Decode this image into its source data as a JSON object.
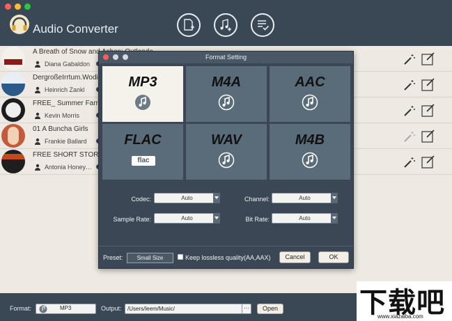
{
  "window": {
    "title": "Audio Converter"
  },
  "toolbar": {
    "icons": [
      "add-file-icon",
      "add-music-icon",
      "checklist-icon"
    ]
  },
  "books": [
    {
      "title": "A Breath of Snow and Ashes: Outlande",
      "author": "Diana Gabaldon",
      "cover_color": "#8b1c1c"
    },
    {
      "title": "DergroßeIrrtum.Wodie",
      "author": "Heinrich Zankl",
      "cover_color": "#2b5a8a"
    },
    {
      "title": "FREE_ Summer Farmer",
      "author": "Kevin Morris",
      "cover_color": "#1d1d1d"
    },
    {
      "title": "01 A Buncha Girls",
      "author": "Frankie Ballard",
      "cover_color": "#c35a3a"
    },
    {
      "title": "FREE SHORT STORY_",
      "author": "Antonia Honey…",
      "cover_color": "#c24a1e"
    }
  ],
  "dialog": {
    "title": "Format Setting",
    "formats": [
      {
        "name": "MP3",
        "selected": true
      },
      {
        "name": "M4A",
        "selected": false
      },
      {
        "name": "AAC",
        "selected": false
      },
      {
        "name": "FLAC",
        "selected": false,
        "badge": "flac"
      },
      {
        "name": "WAV",
        "selected": false
      },
      {
        "name": "M4B",
        "selected": false
      }
    ],
    "codec_label": "Codec:",
    "codec_value": "Auto",
    "channel_label": "Channel:",
    "channel_value": "Auto",
    "sample_rate_label": "Sample Rate:",
    "sample_rate_value": "Auto",
    "bit_rate_label": "Bit Rate:",
    "bit_rate_value": "Auto",
    "preset_label": "Preset:",
    "preset_value": "Small Size",
    "lossless_label": "Keep lossless quality(AA,AAX)",
    "cancel_label": "Cancel",
    "ok_label": "OK"
  },
  "bottom": {
    "format_label": "Format:",
    "format_value": "MP3",
    "output_label": "Output:",
    "output_value": "/Users/leem/Music/",
    "browse_label": "···",
    "open_label": "Open"
  },
  "watermark": {
    "main": "下载吧",
    "url": "www.xiazaiba.com"
  },
  "colors": {
    "header": "#3a4755",
    "list_bg": "#eeeae3",
    "dialog_bg": "#3b4754",
    "tile": "#5a6c7a",
    "tile_selected": "#f5f2ec"
  }
}
